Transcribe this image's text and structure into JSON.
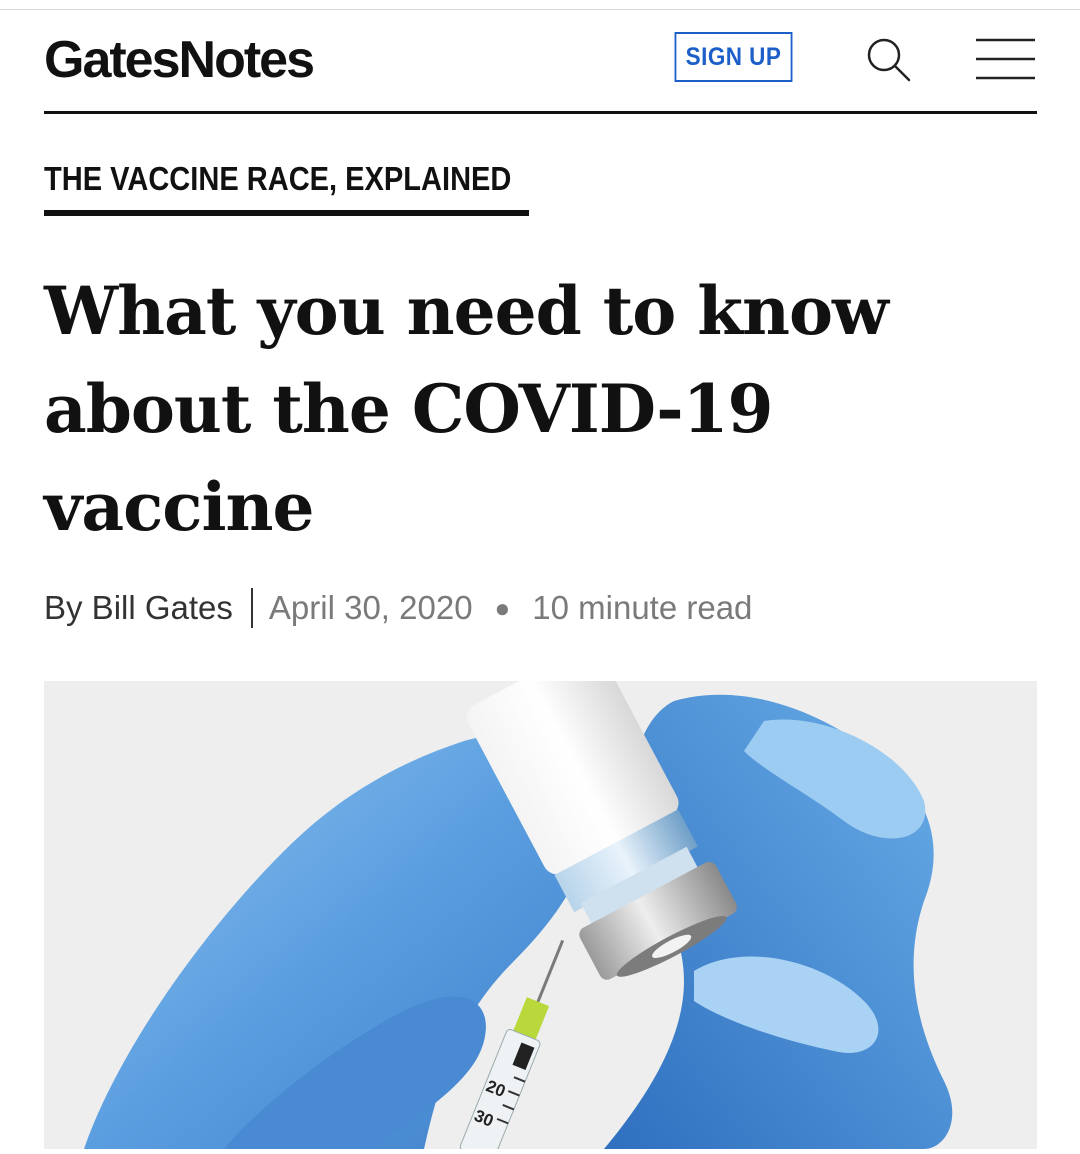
{
  "header": {
    "logo_text": "GatesNotes",
    "signup_label": "SIGN UP",
    "search_icon": "search-icon",
    "menu_icon": "hamburger-menu-icon",
    "accent_color": "#1d5fc9"
  },
  "article": {
    "kicker": "THE VACCINE RACE, EXPLAINED",
    "headline": "What you need to know about the COVID-19 vaccine",
    "author": "By Bill Gates",
    "date": "April 30, 2020",
    "read_time": "10 minute read"
  },
  "hero_image": {
    "syringe_marks": [
      "20",
      "30"
    ]
  }
}
